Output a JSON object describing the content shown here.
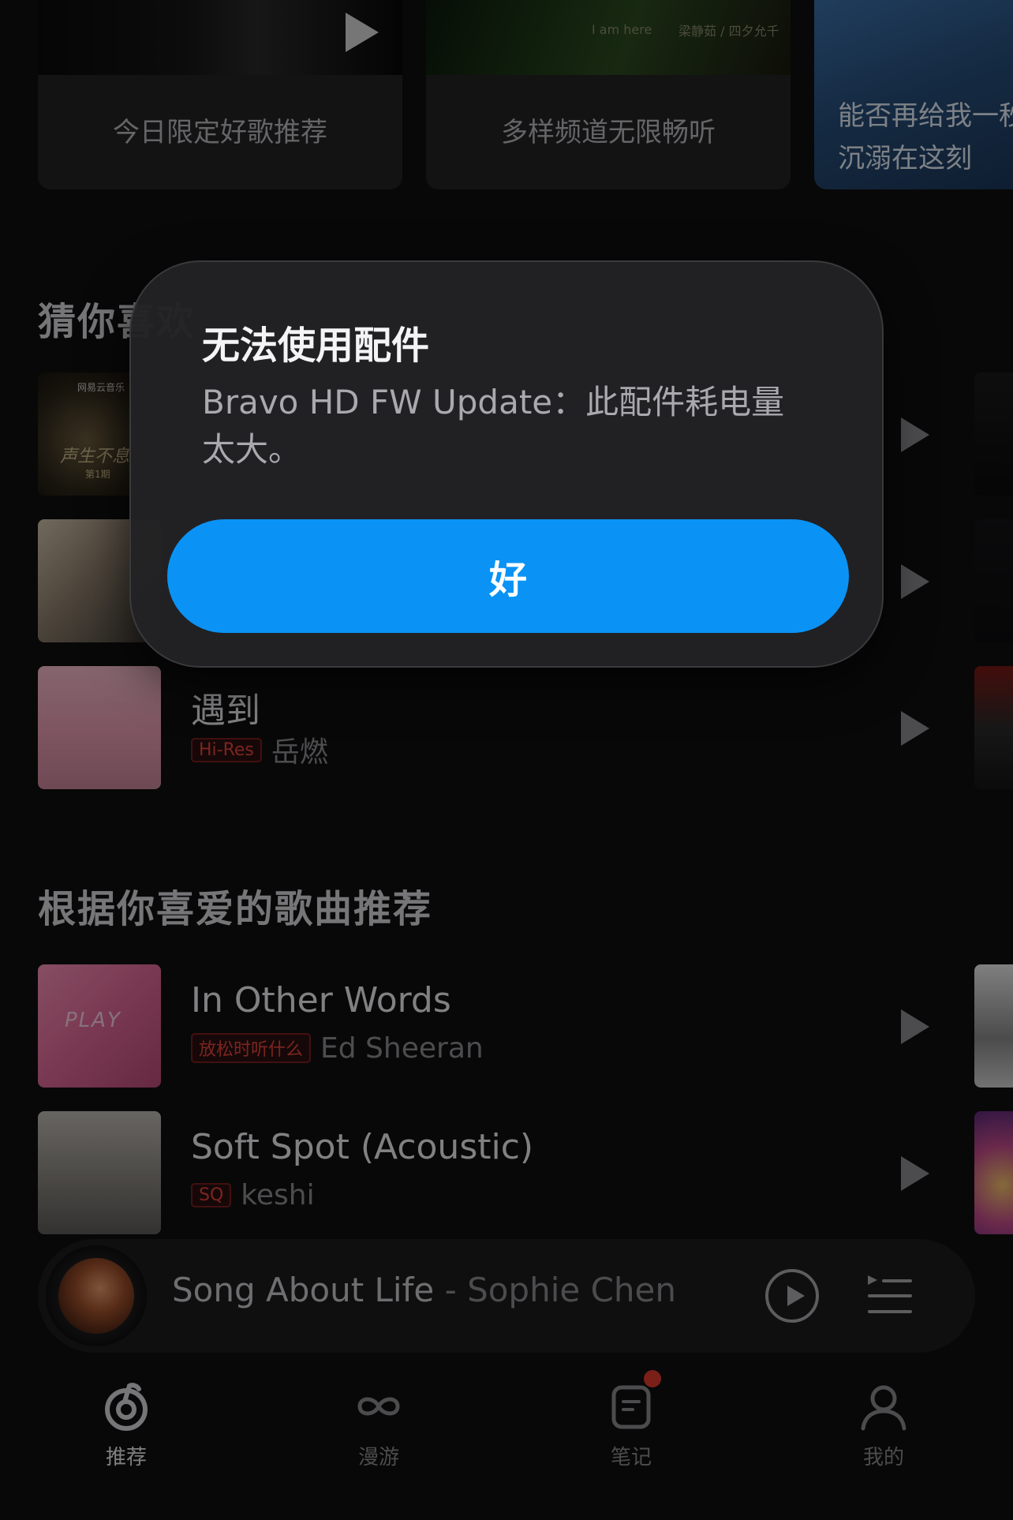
{
  "cards": [
    {
      "label": "今日限定好歌推荐"
    },
    {
      "label": "多样频道无限畅听",
      "tag_en": "I am here",
      "tag_cn": "梁静茹 / 四夕允千"
    },
    {
      "label_line1": "能否再给我一秒",
      "label_line2": "沉溺在这刻"
    }
  ],
  "section_guess": {
    "title": "猜你喜欢",
    "rows": [
      {
        "title": "",
        "cover_caption": "声生不息",
        "cover_sub": "第1期",
        "cover_brand": "网易云音乐"
      },
      {
        "title": ""
      },
      {
        "title": "遇到",
        "tag": "Hi-Res",
        "artist": "岳燃"
      }
    ]
  },
  "section_liked": {
    "title": "根据你喜爱的歌曲推荐",
    "rows": [
      {
        "title": "In Other Words",
        "tag": "放松时听什么",
        "artist": "Ed Sheeran",
        "cover_caption": "PLAY"
      },
      {
        "title": "Soft Spot (Acoustic)",
        "tag": "SQ",
        "artist": "keshi"
      }
    ]
  },
  "dialog": {
    "title": "无法使用配件",
    "message": "Bravo HD FW Update：此配件耗电量太大。",
    "ok_label": "好"
  },
  "mini_player": {
    "song": "Song About Life",
    "separator": " - ",
    "artist": "Sophie Chen"
  },
  "tabs": [
    {
      "label": "推荐",
      "icon": "netease-logo-icon",
      "active": true
    },
    {
      "label": "漫游",
      "icon": "infinity-icon",
      "active": false
    },
    {
      "label": "笔记",
      "icon": "note-icon",
      "active": false,
      "badge": true
    },
    {
      "label": "我的",
      "icon": "person-icon",
      "active": false
    }
  ],
  "colors": {
    "accent_button": "#0a93f5",
    "tag_red": "#e0443a",
    "background": "#0f0f10"
  }
}
